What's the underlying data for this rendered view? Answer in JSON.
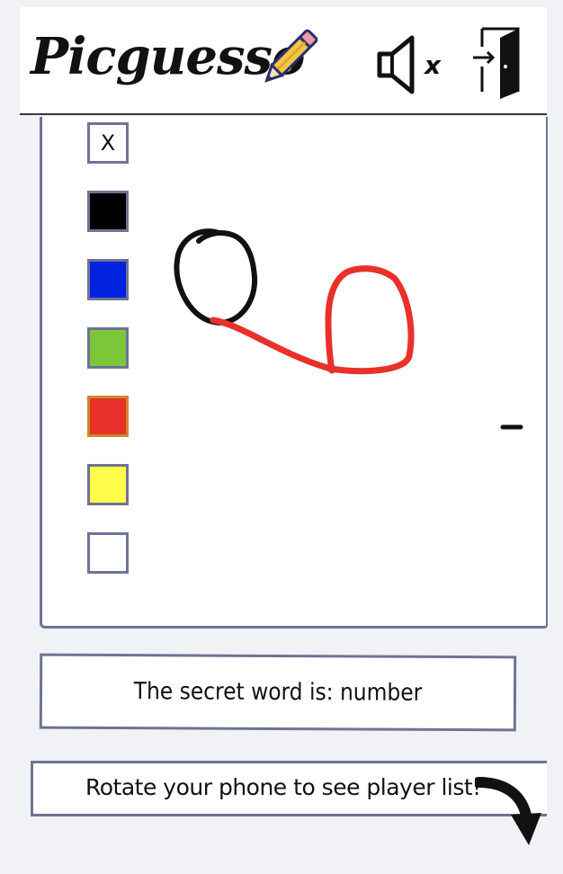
{
  "app": {
    "title": "Picguesso"
  },
  "header": {
    "mute_icon": "speaker-muted-icon",
    "mute_mark": "x",
    "exit_icon": "exit-door-icon"
  },
  "palette": {
    "eraser_label": "X",
    "colors": [
      "#000000",
      "#0022e0",
      "#7dc63a",
      "#e8312a",
      "#fefe4a",
      "#ffffff"
    ]
  },
  "strokes": [
    {
      "color": "#111111"
    },
    {
      "color": "#e8312a"
    },
    {
      "color": "#111111"
    }
  ],
  "game": {
    "secret_word_text": "The secret word is: number",
    "rotate_hint": "Rotate your phone to see player list!"
  }
}
